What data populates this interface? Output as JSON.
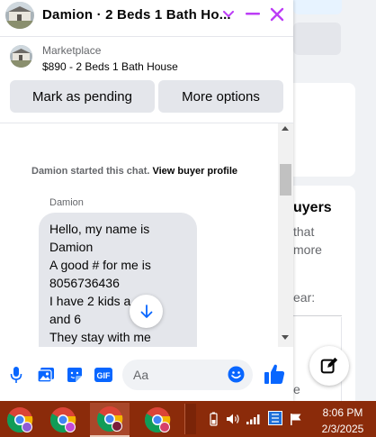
{
  "background": {
    "partial_heading": "uyers",
    "partial_line_1": "that",
    "partial_line_2": "more",
    "partial_line_3": "ear:",
    "partial_line_4": "e"
  },
  "chat": {
    "title": "Damion · 2 Beds 1 Bath Ho...",
    "marketplace_label": "Marketplace",
    "listing": "$890 - 2 Beds 1 Bath House",
    "mark_pending_label": "Mark as pending",
    "more_options_label": "More options",
    "system_message": "Damion started this chat.",
    "view_profile_link": "View buyer profile",
    "sender_name": "Damion",
    "message_lines": [
      "Hello, my name is",
      "Damion",
      "A good # for me is",
      "8056736436",
      "I have 2 kids a      4",
      "and 6",
      "They stay with me"
    ],
    "composer_placeholder": "Aa",
    "gif_label": "GIF"
  },
  "colors": {
    "accent": "#0866ff",
    "header_icon": "#bc3df6",
    "taskbar": "#8b2b0a"
  },
  "icons": {
    "chevron": "chevron-down-icon",
    "minimize": "minimize-icon",
    "close": "close-icon",
    "mic": "microphone-icon",
    "photo": "photo-icon",
    "sticker": "sticker-icon",
    "gif": "gif-icon",
    "emoji": "emoji-icon",
    "like": "thumbs-up-icon",
    "compose": "compose-icon"
  },
  "taskbar": {
    "time": "8:06 PM",
    "date": "2/3/2025"
  }
}
